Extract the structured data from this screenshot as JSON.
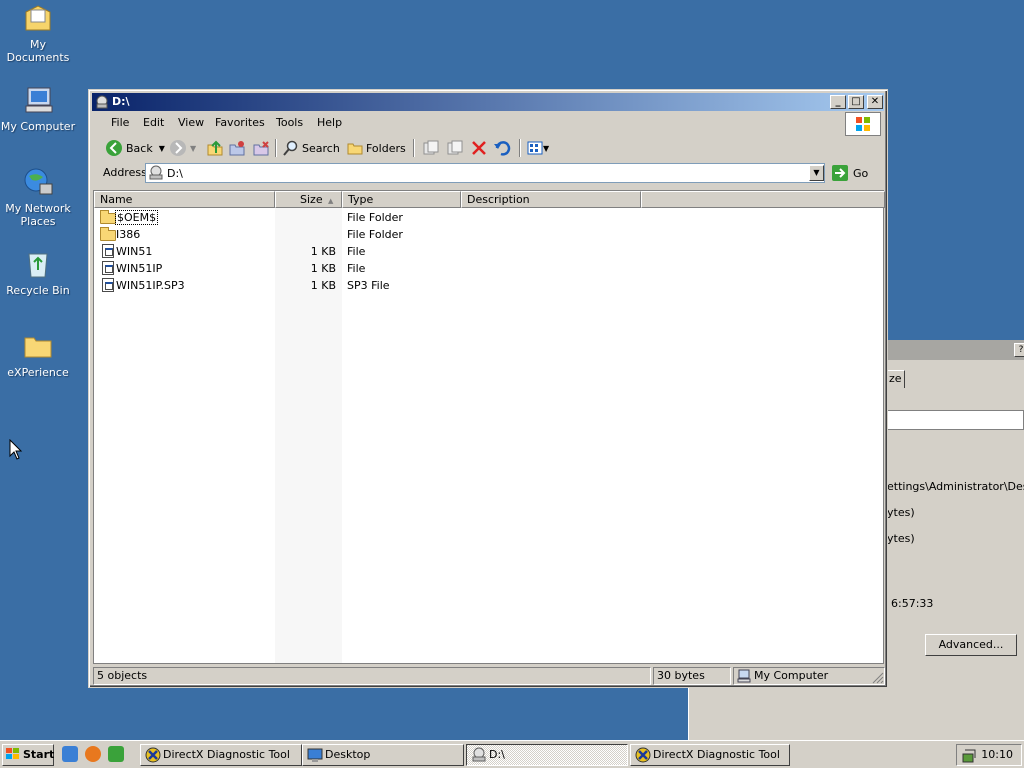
{
  "desktop": {
    "icons": [
      {
        "label": "My Documents",
        "icon": "my-documents-icon"
      },
      {
        "label": "My Computer",
        "icon": "my-computer-icon"
      },
      {
        "label": "My Network Places",
        "icon": "network-places-icon"
      },
      {
        "label": "Recycle Bin",
        "icon": "recycle-bin-icon"
      },
      {
        "label": "eXPerience",
        "icon": "folder-icon"
      }
    ]
  },
  "background_dialog": {
    "tab_partial": "ze",
    "path_partial": "ettings\\Administrator\\Desktop",
    "line1_partial": "ytes)",
    "line2_partial": "ytes)",
    "time_partial": "6:57:33",
    "advanced_button": "Advanced..."
  },
  "window": {
    "title": "D:\\",
    "controls": {
      "minimize": "_",
      "maximize": "□",
      "close": "✕"
    },
    "menu": [
      "File",
      "Edit",
      "View",
      "Favorites",
      "Tools",
      "Help"
    ],
    "toolbar": {
      "back": "Back",
      "search": "Search",
      "folders": "Folders"
    },
    "address": {
      "label": "Address",
      "value": "D:\\",
      "go": "Go"
    },
    "columns": [
      "Name",
      "Size",
      "Type",
      "Description"
    ],
    "files": [
      {
        "name": "$OEM$",
        "size": "",
        "type": "File Folder",
        "kind": "folder"
      },
      {
        "name": "I386",
        "size": "",
        "type": "File Folder",
        "kind": "folder"
      },
      {
        "name": "WIN51",
        "size": "1 KB",
        "type": "File",
        "kind": "file"
      },
      {
        "name": "WIN51IP",
        "size": "1 KB",
        "type": "File",
        "kind": "file"
      },
      {
        "name": "WIN51IP.SP3",
        "size": "1 KB",
        "type": "SP3 File",
        "kind": "file"
      }
    ],
    "status": {
      "objects": "5 objects",
      "bytes": "30 bytes",
      "zone": "My Computer"
    }
  },
  "taskbar": {
    "start": "Start",
    "buttons": [
      {
        "label": "DirectX Diagnostic Tool",
        "active": false
      },
      {
        "label": "Desktop",
        "active": false
      },
      {
        "label": "D:\\",
        "active": true
      },
      {
        "label": "DirectX Diagnostic Tool",
        "active": false
      }
    ],
    "clock": "10:10"
  },
  "colors": {
    "desktop": "#3a6ea5",
    "titlebar_start": "#0a246a",
    "titlebar_end": "#a6caf0",
    "face": "#d4d0c8"
  }
}
